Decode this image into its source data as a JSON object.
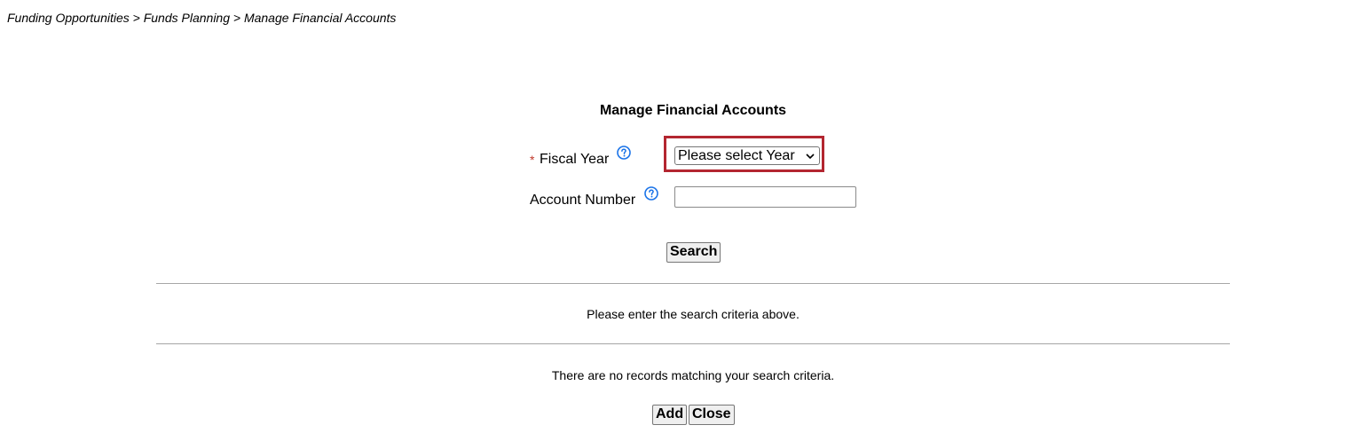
{
  "breadcrumb": "Funding Opportunities > Funds Planning > Manage Financial Accounts",
  "page_title": "Manage Financial Accounts",
  "form": {
    "fiscal_year": {
      "required_marker": "*",
      "label": "Fiscal Year",
      "selected_value": "Please select Year"
    },
    "account_number": {
      "label": "Account Number",
      "value": ""
    }
  },
  "buttons": {
    "search": "Search",
    "add": "Add",
    "close": "Close"
  },
  "messages": {
    "criteria": "Please enter the search criteria above.",
    "no_records": "There are no records matching your search criteria."
  },
  "colors": {
    "highlight_border": "#b32630",
    "help_icon": "#1a73e8",
    "required_star": "#c0392b"
  },
  "icons": {
    "help": "help-circle-icon",
    "dropdown": "chevron-down-icon"
  }
}
